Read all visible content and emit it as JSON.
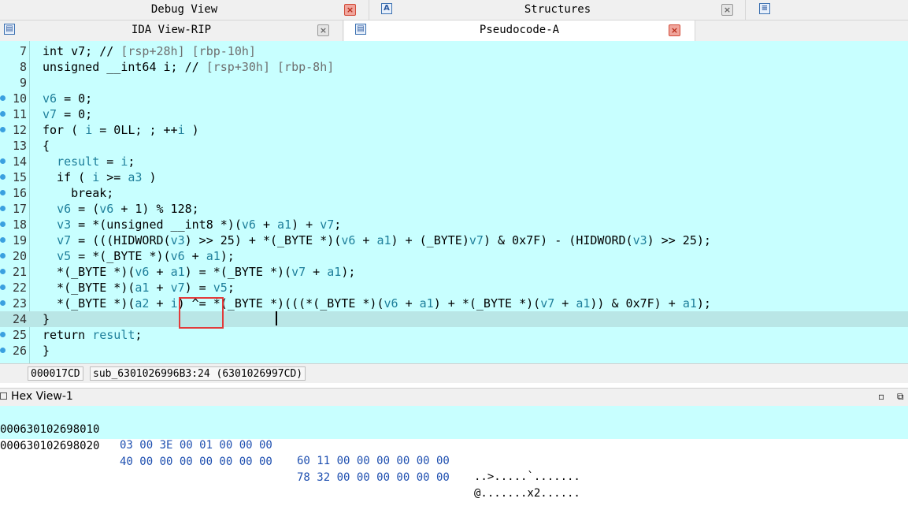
{
  "tabs_top": {
    "debug_view": "Debug View",
    "structures": "Structures"
  },
  "tabs_second": {
    "ida_view": "IDA View-RIP",
    "pseudocode": "Pseudocode-A"
  },
  "code_lines": [
    {
      "num": "7",
      "bp": false,
      "current": false,
      "segs": [
        [
          "",
          "int v7; // "
        ],
        [
          "cm",
          "[rsp+28h] [rbp-10h]"
        ]
      ]
    },
    {
      "num": "8",
      "bp": false,
      "current": false,
      "segs": [
        [
          "",
          "unsigned __int64 i; // "
        ],
        [
          "cm",
          "[rsp+30h] [rbp-8h]"
        ]
      ]
    },
    {
      "num": "9",
      "bp": false,
      "current": false,
      "segs": []
    },
    {
      "num": "10",
      "bp": true,
      "current": false,
      "segs": [
        [
          "nm",
          "v6"
        ],
        [
          "",
          " = 0;"
        ]
      ]
    },
    {
      "num": "11",
      "bp": true,
      "current": false,
      "segs": [
        [
          "nm",
          "v7"
        ],
        [
          "",
          " = 0;"
        ]
      ]
    },
    {
      "num": "12",
      "bp": true,
      "current": false,
      "segs": [
        [
          "",
          "for ( "
        ],
        [
          "nm",
          "i"
        ],
        [
          "",
          " = 0LL; ; ++"
        ],
        [
          "nm",
          "i"
        ],
        [
          "",
          " )"
        ]
      ]
    },
    {
      "num": "13",
      "bp": false,
      "current": false,
      "segs": [
        [
          "",
          "{"
        ]
      ]
    },
    {
      "num": "14",
      "bp": true,
      "current": false,
      "segs": [
        [
          "",
          "  "
        ],
        [
          "nm",
          "result"
        ],
        [
          "",
          " = "
        ],
        [
          "nm",
          "i"
        ],
        [
          "",
          ";"
        ]
      ]
    },
    {
      "num": "15",
      "bp": true,
      "current": false,
      "segs": [
        [
          "",
          "  if ( "
        ],
        [
          "nm",
          "i"
        ],
        [
          "",
          " >= "
        ],
        [
          "nm",
          "a3"
        ],
        [
          "",
          " )"
        ]
      ]
    },
    {
      "num": "16",
      "bp": true,
      "current": false,
      "segs": [
        [
          "",
          "    break;"
        ]
      ]
    },
    {
      "num": "17",
      "bp": true,
      "current": false,
      "segs": [
        [
          "",
          "  "
        ],
        [
          "nm",
          "v6"
        ],
        [
          "",
          " = ("
        ],
        [
          "nm",
          "v6"
        ],
        [
          "",
          " + 1) % 128;"
        ]
      ]
    },
    {
      "num": "18",
      "bp": true,
      "current": false,
      "segs": [
        [
          "",
          "  "
        ],
        [
          "nm",
          "v3"
        ],
        [
          "",
          " = *(unsigned __int8 *)("
        ],
        [
          "nm",
          "v6"
        ],
        [
          "",
          " + "
        ],
        [
          "nm",
          "a1"
        ],
        [
          "",
          ") + "
        ],
        [
          "nm",
          "v7"
        ],
        [
          "",
          ";"
        ]
      ]
    },
    {
      "num": "19",
      "bp": true,
      "current": false,
      "segs": [
        [
          "",
          "  "
        ],
        [
          "nm",
          "v7"
        ],
        [
          "",
          " = (((HIDWORD("
        ],
        [
          "nm",
          "v3"
        ],
        [
          "",
          ") >> 25) + *(_BYTE *)("
        ],
        [
          "nm",
          "v6"
        ],
        [
          "",
          " + "
        ],
        [
          "nm",
          "a1"
        ],
        [
          "",
          ") + (_BYTE)"
        ],
        [
          "nm",
          "v7"
        ],
        [
          "",
          ") & 0x7F) - (HIDWORD("
        ],
        [
          "nm",
          "v3"
        ],
        [
          "",
          ") >> 25);"
        ]
      ]
    },
    {
      "num": "20",
      "bp": true,
      "current": false,
      "segs": [
        [
          "",
          "  "
        ],
        [
          "nm",
          "v5"
        ],
        [
          "",
          " = *(_BYTE *)("
        ],
        [
          "nm",
          "v6"
        ],
        [
          "",
          " + "
        ],
        [
          "nm",
          "a1"
        ],
        [
          "",
          ");"
        ]
      ]
    },
    {
      "num": "21",
      "bp": true,
      "current": false,
      "segs": [
        [
          "",
          "  *(_BYTE *)("
        ],
        [
          "nm",
          "v6"
        ],
        [
          "",
          " + "
        ],
        [
          "nm",
          "a1"
        ],
        [
          "",
          ") = *(_BYTE *)("
        ],
        [
          "nm",
          "v7"
        ],
        [
          "",
          " + "
        ],
        [
          "nm",
          "a1"
        ],
        [
          "",
          ");"
        ]
      ]
    },
    {
      "num": "22",
      "bp": true,
      "current": false,
      "segs": [
        [
          "",
          "  *(_BYTE *)("
        ],
        [
          "nm",
          "a1"
        ],
        [
          "",
          " + "
        ],
        [
          "nm",
          "v7"
        ],
        [
          "",
          ") = "
        ],
        [
          "nm",
          "v5"
        ],
        [
          "",
          ";"
        ]
      ]
    },
    {
      "num": "23",
      "bp": true,
      "current": false,
      "segs": [
        [
          "",
          "  *(_BYTE *)("
        ],
        [
          "nm",
          "a2"
        ],
        [
          "",
          " + "
        ],
        [
          "nm",
          "i"
        ],
        [
          "",
          ") ^= *(_BYTE *)(((*(_BYTE *)("
        ],
        [
          "nm",
          "v6"
        ],
        [
          "",
          " + "
        ],
        [
          "nm",
          "a1"
        ],
        [
          "",
          ") + *(_BYTE *)("
        ],
        [
          "nm",
          "v7"
        ],
        [
          "",
          " + "
        ],
        [
          "nm",
          "a1"
        ],
        [
          "",
          ")) & 0x7F) + "
        ],
        [
          "nm",
          "a1"
        ],
        [
          "",
          ");"
        ]
      ]
    },
    {
      "num": "24",
      "bp": false,
      "current": true,
      "segs": [
        [
          "",
          "}"
        ]
      ]
    },
    {
      "num": "25",
      "bp": true,
      "current": false,
      "segs": [
        [
          "",
          "return "
        ],
        [
          "nm",
          "result"
        ],
        [
          "",
          ";"
        ]
      ]
    },
    {
      "num": "26",
      "bp": true,
      "current": false,
      "segs": [
        [
          "",
          "}"
        ]
      ]
    }
  ],
  "status": {
    "offset": "000017CD",
    "location": "sub_6301026996B3:24 (6301026997CD)"
  },
  "hex_view": {
    "title": "Hex View-1",
    "rows": [
      {
        "addr": "000630102698010",
        "b1": "03 00 3E 00 01 00 00 00",
        "b2": "60 11 00 00 00 00 00 00",
        "ascii": "..>.....`......."
      },
      {
        "addr": "000630102698020",
        "b1": "40 00 00 00 00 00 00 00",
        "b2": "78 32 00 00 00 00 00 00",
        "ascii": "@.......x2......"
      }
    ]
  },
  "colors": {
    "code_bg": "#c8ffff",
    "current_line": "#b9e6e6",
    "identifier": "#1e7f9b",
    "comment": "#6e6e6e",
    "breakpoint_dot": "#3aa0e0",
    "highlight_box": "#e23a3a"
  }
}
